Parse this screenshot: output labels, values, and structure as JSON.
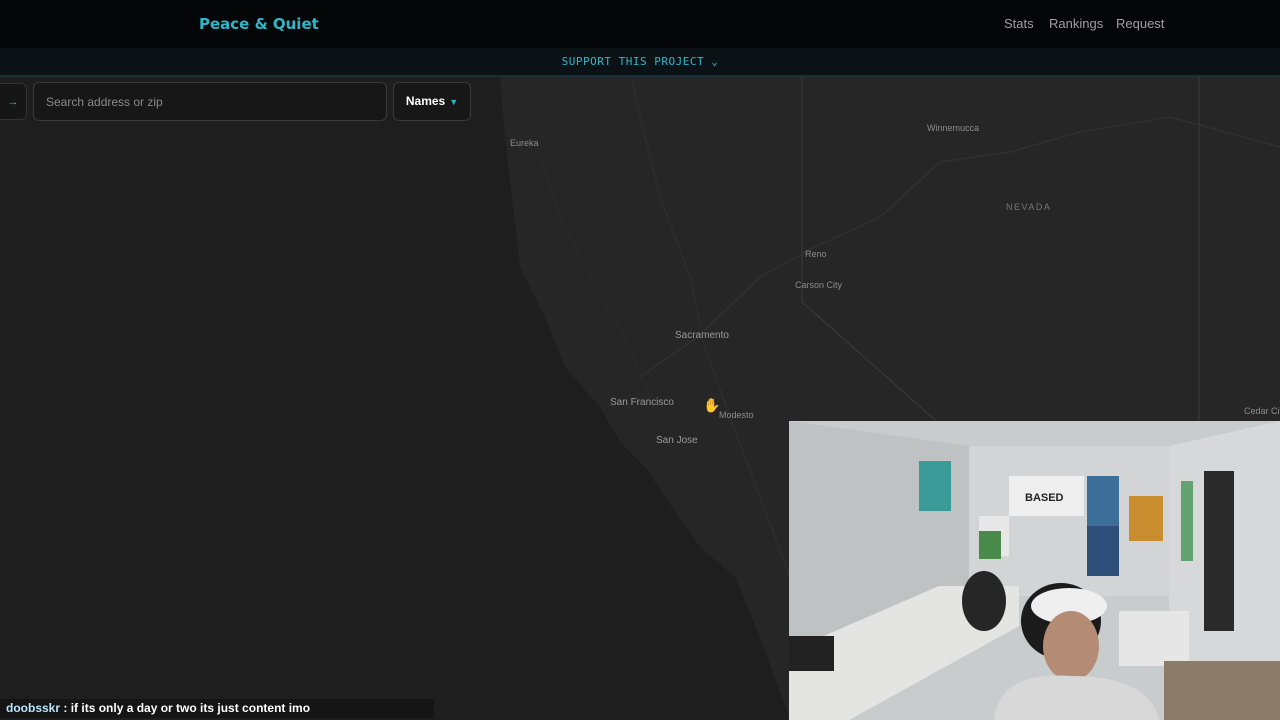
{
  "header": {
    "brand": "Peace & Quiet",
    "nav": [
      "Stats",
      "Rankings",
      "Request"
    ]
  },
  "support_banner": "SUPPORT THIS PROJECT ⌄",
  "search": {
    "back_arrow": "→",
    "placeholder": "Search address or zip"
  },
  "names_dropdown": {
    "label": "Names",
    "caret": "▼"
  },
  "map": {
    "places": [
      "Eureka",
      "Winnemucca",
      "NEVADA",
      "Reno",
      "Carson City",
      "Sacramento",
      "San Francisco",
      "Modesto",
      "San Jose",
      "Cedar Cit"
    ]
  },
  "chat": {
    "user": "doobsskr",
    "separator": ":",
    "message": "if its only a day or two its just content imo"
  },
  "webcam": {
    "poster_text": "BASED"
  },
  "colors": {
    "accent": "#2fb7c9",
    "map_land": "#262626",
    "map_water": "#1c1c1c",
    "header_bg": "#050607"
  }
}
